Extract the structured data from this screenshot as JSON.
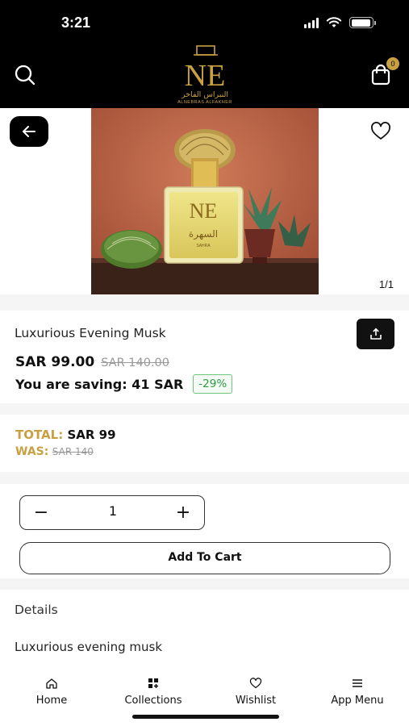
{
  "status_bar": {
    "time": "3:21",
    "battery_level": 0.95
  },
  "header": {
    "logo_mark": "NE",
    "logo_arabic": "النبراس الفاخر",
    "logo_english": "ALNEBRAS ALFAKHER",
    "cart_count": "0",
    "icons": {
      "search": "search-icon",
      "cart": "shopping-bag-icon"
    }
  },
  "gallery": {
    "counter": "1/1",
    "image_label_arabic": "السهرة",
    "image_label_english": "SAHRA",
    "icons": {
      "back": "arrow-left-icon",
      "wishlist": "heart-icon"
    }
  },
  "product": {
    "title": "Luxurious Evening Musk",
    "price_now": "SAR 99.00",
    "price_was": "SAR 140.00",
    "saving_text": "You are saving: 41 SAR",
    "discount": "-29%"
  },
  "totals": {
    "total_label": "TOTAL:",
    "total_value": "SAR 99",
    "was_label": "WAS:",
    "was_value": "SAR 140"
  },
  "quantity": {
    "minus": "−",
    "value": "1",
    "plus": "+"
  },
  "actions": {
    "add_to_cart": "Add To Cart"
  },
  "details": {
    "heading": "Details",
    "description": "Luxurious evening musk"
  },
  "bottom_nav": {
    "items": [
      {
        "label": "Home",
        "icon": "home-icon"
      },
      {
        "label": "Collections",
        "icon": "grid-icon"
      },
      {
        "label": "Wishlist",
        "icon": "heart-icon"
      },
      {
        "label": "App Menu",
        "icon": "menu-icon"
      }
    ]
  },
  "colors": {
    "brand_gold": "#c9a041",
    "header_bg": "#000000",
    "discount_green": "#2f9a43"
  }
}
